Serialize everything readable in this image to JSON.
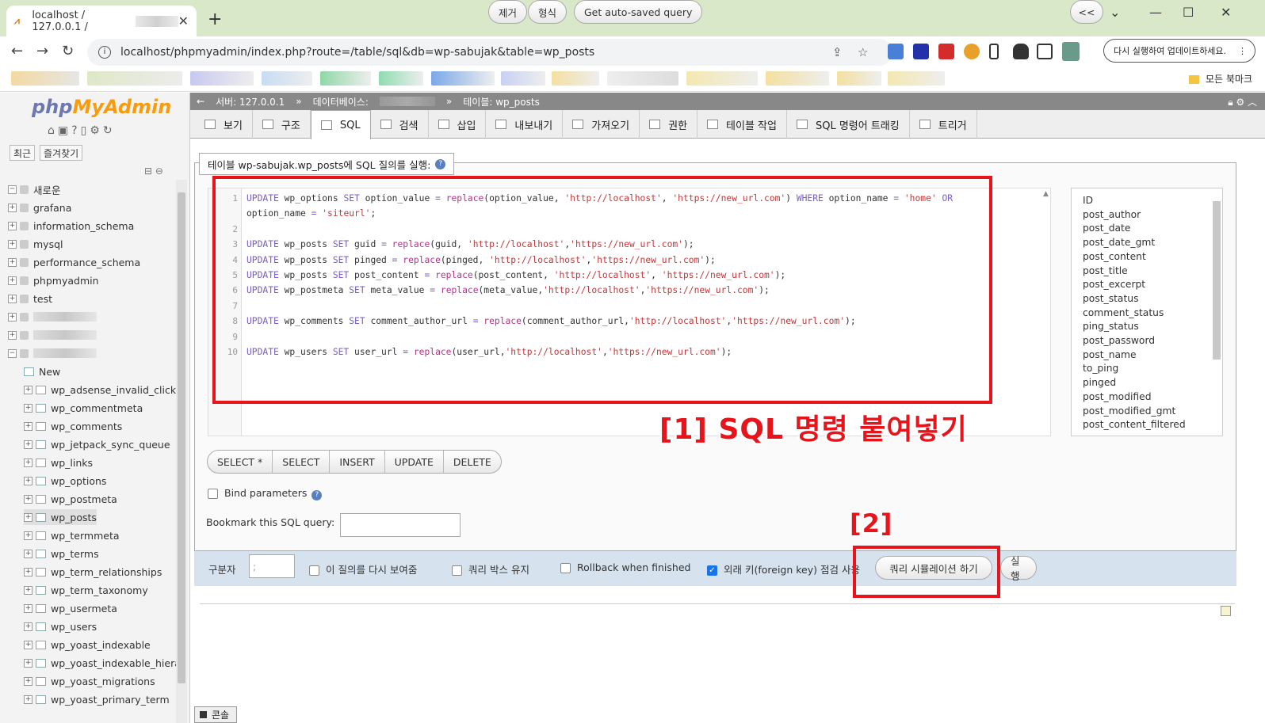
{
  "browser": {
    "tab_title": "localhost / 127.0.0.1 /",
    "url": "localhost/phpmyadmin/index.php?route=/table/sql&db=wp-sabujak&table=wp_posts",
    "update_button": "다시 실행하여 업데이트하세요.",
    "all_bookmarks": "모든 북마크"
  },
  "sidebar": {
    "logo_php": "php",
    "logo_myadmin": "MyAdmin",
    "recent": "최근",
    "favorites": "즐겨찾기",
    "new_item": "새로운",
    "databases": [
      "grafana",
      "information_schema",
      "mysql",
      "performance_schema",
      "phpmyadmin",
      "test"
    ],
    "new_table": "New",
    "tables": [
      "wp_adsense_invalid_click_p",
      "wp_commentmeta",
      "wp_comments",
      "wp_jetpack_sync_queue",
      "wp_links",
      "wp_options",
      "wp_postmeta",
      "wp_posts",
      "wp_termmeta",
      "wp_terms",
      "wp_term_relationships",
      "wp_term_taxonomy",
      "wp_usermeta",
      "wp_users",
      "wp_yoast_indexable",
      "wp_yoast_indexable_hierar",
      "wp_yoast_migrations",
      "wp_yoast_primary_term"
    ]
  },
  "breadcrumb": {
    "server": "서버: 127.0.0.1",
    "database": "데이터베이스:",
    "table": "테이블: wp_posts"
  },
  "tabs": [
    "보기",
    "구조",
    "SQL",
    "검색",
    "삽입",
    "내보내기",
    "가져오기",
    "권한",
    "테이블 작업",
    "SQL 명령어 트래킹",
    "트리거"
  ],
  "query_legend": "테이블 wp-sabujak.wp_posts에 SQL 질의를 실행:",
  "editor": {
    "lines": [
      {
        "n": "1",
        "parts": [
          [
            "kw",
            "UPDATE "
          ],
          [
            "",
            "wp_options "
          ],
          [
            "kw",
            "SET "
          ],
          [
            "",
            "option_value "
          ],
          [
            "kw",
            "= "
          ],
          [
            "fn",
            "replace"
          ],
          [
            "",
            "(option_value, "
          ],
          [
            "st",
            "'http://localhost'"
          ],
          [
            "",
            ", "
          ],
          [
            "st",
            "'https://new_url.com'"
          ],
          [
            "",
            ") "
          ],
          [
            "kw",
            "WHERE "
          ],
          [
            "",
            "option_name "
          ],
          [
            "kw",
            "= "
          ],
          [
            "st",
            "'home' "
          ],
          [
            "kw",
            "OR"
          ]
        ]
      },
      {
        "n": "",
        "parts": [
          [
            "",
            "option_name "
          ],
          [
            "kw",
            "= "
          ],
          [
            "st",
            "'siteurl'"
          ],
          [
            "",
            ";"
          ]
        ]
      },
      {
        "n": "2",
        "parts": []
      },
      {
        "n": "3",
        "parts": [
          [
            "kw",
            "UPDATE "
          ],
          [
            "",
            "wp_posts "
          ],
          [
            "kw",
            "SET "
          ],
          [
            "",
            "guid "
          ],
          [
            "kw",
            "= "
          ],
          [
            "fn",
            "replace"
          ],
          [
            "",
            "(guid, "
          ],
          [
            "st",
            "'http://localhost'"
          ],
          [
            "",
            ","
          ],
          [
            "st",
            "'https://new_url.com'"
          ],
          [
            "",
            ");"
          ]
        ]
      },
      {
        "n": "4",
        "parts": [
          [
            "kw",
            "UPDATE "
          ],
          [
            "",
            "wp_posts "
          ],
          [
            "kw",
            "SET "
          ],
          [
            "",
            "pinged "
          ],
          [
            "kw",
            "= "
          ],
          [
            "fn",
            "replace"
          ],
          [
            "",
            "(pinged, "
          ],
          [
            "st",
            "'http://localhost'"
          ],
          [
            "",
            ","
          ],
          [
            "st",
            "'https://new_url.com'"
          ],
          [
            "",
            ");"
          ]
        ]
      },
      {
        "n": "5",
        "parts": [
          [
            "kw",
            "UPDATE "
          ],
          [
            "",
            "wp_posts "
          ],
          [
            "kw",
            "SET "
          ],
          [
            "",
            "post_content "
          ],
          [
            "kw",
            "= "
          ],
          [
            "fn",
            "replace"
          ],
          [
            "",
            "(post_content, "
          ],
          [
            "st",
            "'http://localhost'"
          ],
          [
            "",
            ", "
          ],
          [
            "st",
            "'https://new_url.com'"
          ],
          [
            "",
            ");"
          ]
        ]
      },
      {
        "n": "6",
        "parts": [
          [
            "kw",
            "UPDATE "
          ],
          [
            "",
            "wp_postmeta "
          ],
          [
            "kw",
            "SET "
          ],
          [
            "",
            "meta_value "
          ],
          [
            "kw",
            "= "
          ],
          [
            "fn",
            "replace"
          ],
          [
            "",
            "(meta_value,"
          ],
          [
            "st",
            "'http://localhost'"
          ],
          [
            "",
            ","
          ],
          [
            "st",
            "'https://new_url.com'"
          ],
          [
            "",
            ");"
          ]
        ]
      },
      {
        "n": "7",
        "parts": []
      },
      {
        "n": "8",
        "parts": [
          [
            "kw",
            "UPDATE "
          ],
          [
            "",
            "wp_comments "
          ],
          [
            "kw",
            "SET "
          ],
          [
            "",
            "comment_author_url "
          ],
          [
            "kw",
            "= "
          ],
          [
            "fn",
            "replace"
          ],
          [
            "",
            "(comment_author_url,"
          ],
          [
            "st",
            "'http://localhost'"
          ],
          [
            "",
            ","
          ],
          [
            "st",
            "'https://new_url.com'"
          ],
          [
            "",
            ");"
          ]
        ]
      },
      {
        "n": "9",
        "parts": []
      },
      {
        "n": "10",
        "parts": [
          [
            "kw",
            "UPDATE "
          ],
          [
            "",
            "wp_users "
          ],
          [
            "kw",
            "SET "
          ],
          [
            "",
            "user_url "
          ],
          [
            "kw",
            "= "
          ],
          [
            "fn",
            "replace"
          ],
          [
            "",
            "(user_url,"
          ],
          [
            "st",
            "'http://localhost'"
          ],
          [
            "",
            ","
          ],
          [
            "st",
            "'https://new_url.com'"
          ],
          [
            "",
            ");"
          ]
        ]
      }
    ]
  },
  "columns": [
    "ID",
    "post_author",
    "post_date",
    "post_date_gmt",
    "post_content",
    "post_title",
    "post_excerpt",
    "post_status",
    "comment_status",
    "ping_status",
    "post_password",
    "post_name",
    "to_ping",
    "pinged",
    "post_modified",
    "post_modified_gmt",
    "post_content_filtered"
  ],
  "query_buttons": [
    "SELECT *",
    "SELECT",
    "INSERT",
    "UPDATE",
    "DELETE"
  ],
  "clear_button": "제거",
  "format_button": "형식",
  "autosave_button": "Get auto-saved query",
  "collapse_button": "<<",
  "bind_parameters": "Bind parameters",
  "bookmark_label": "Bookmark this SQL query:",
  "footer": {
    "delimiter_label": "구분자",
    "delimiter_value": ";",
    "show_again": "이 질의를 다시 보여줌",
    "keep_box": "쿼리 박스 유지",
    "rollback": "Rollback when finished",
    "foreign_key": "외래 키(foreign key) 점검 사용",
    "simulate": "쿼리 시뮬레이션 하기",
    "go": "실행"
  },
  "annotations": {
    "step1": "[1] SQL 명령 붙여넣기",
    "step2": "[2]"
  },
  "console": "콘솔",
  "colors": {
    "annotation_red": "#e8141b",
    "pma_blue": "#6c78af",
    "pma_orange": "#f89c0e"
  }
}
